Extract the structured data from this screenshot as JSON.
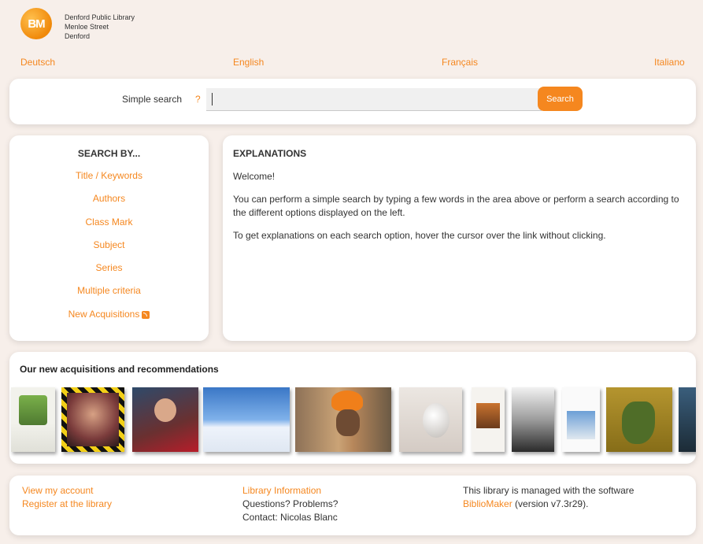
{
  "library": {
    "logo_text": "BM",
    "name": "Denford Public Library",
    "street": "Menloe Street",
    "city": "Denford"
  },
  "languages": [
    "Deutsch",
    "English",
    "Français",
    "Italiano"
  ],
  "search": {
    "label": "Simple search",
    "help": "?",
    "value": "",
    "button": "Search"
  },
  "search_by": {
    "title": "SEARCH BY...",
    "links": [
      "Title / Keywords",
      "Authors",
      "Class Mark",
      "Subject",
      "Series",
      "Multiple criteria",
      "New Acquisitions"
    ]
  },
  "explanations": {
    "title": "EXPLANATIONS",
    "paragraphs": [
      "Welcome!",
      "You can perform a simple search by typing a few words in the area above or perform a search according to the different options displayed on the left.",
      "To get explanations on each search option, hover the cursor over the link without clicking."
    ]
  },
  "acquisitions": {
    "title": "Our new acquisitions and recommendations"
  },
  "footer": {
    "view_account": "View my account",
    "register": "Register at the library",
    "library_info": "Library Information",
    "questions": "Questions? Problems?",
    "contact": "Contact: Nicolas Blanc",
    "managed": "This library is managed with the software",
    "software": "BiblioMaker",
    "version": " (version v7.3r29)."
  },
  "colors": {
    "accent": "#f5871f",
    "background": "#f7efea"
  }
}
